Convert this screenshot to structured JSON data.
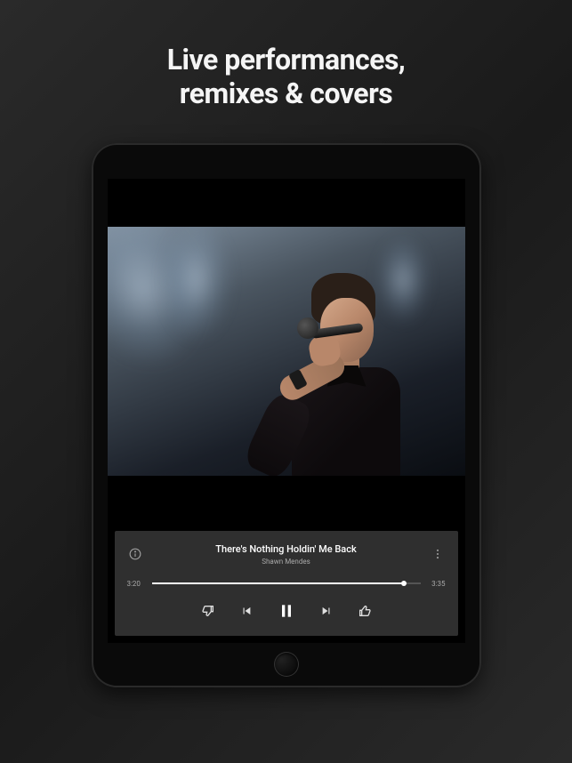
{
  "headline": {
    "line1": "Live performances,",
    "line2": "remixes & covers"
  },
  "player": {
    "track_title": "There's Nothing Holdin' Me Back",
    "track_artist": "Shawn Mendes",
    "time_elapsed": "3:20",
    "time_total": "3:35",
    "progress_percent": 94
  },
  "icons": {
    "info": "info",
    "more": "more",
    "dislike": "thumb-down",
    "previous": "previous",
    "pause": "pause",
    "next": "next",
    "like": "thumb-up"
  }
}
